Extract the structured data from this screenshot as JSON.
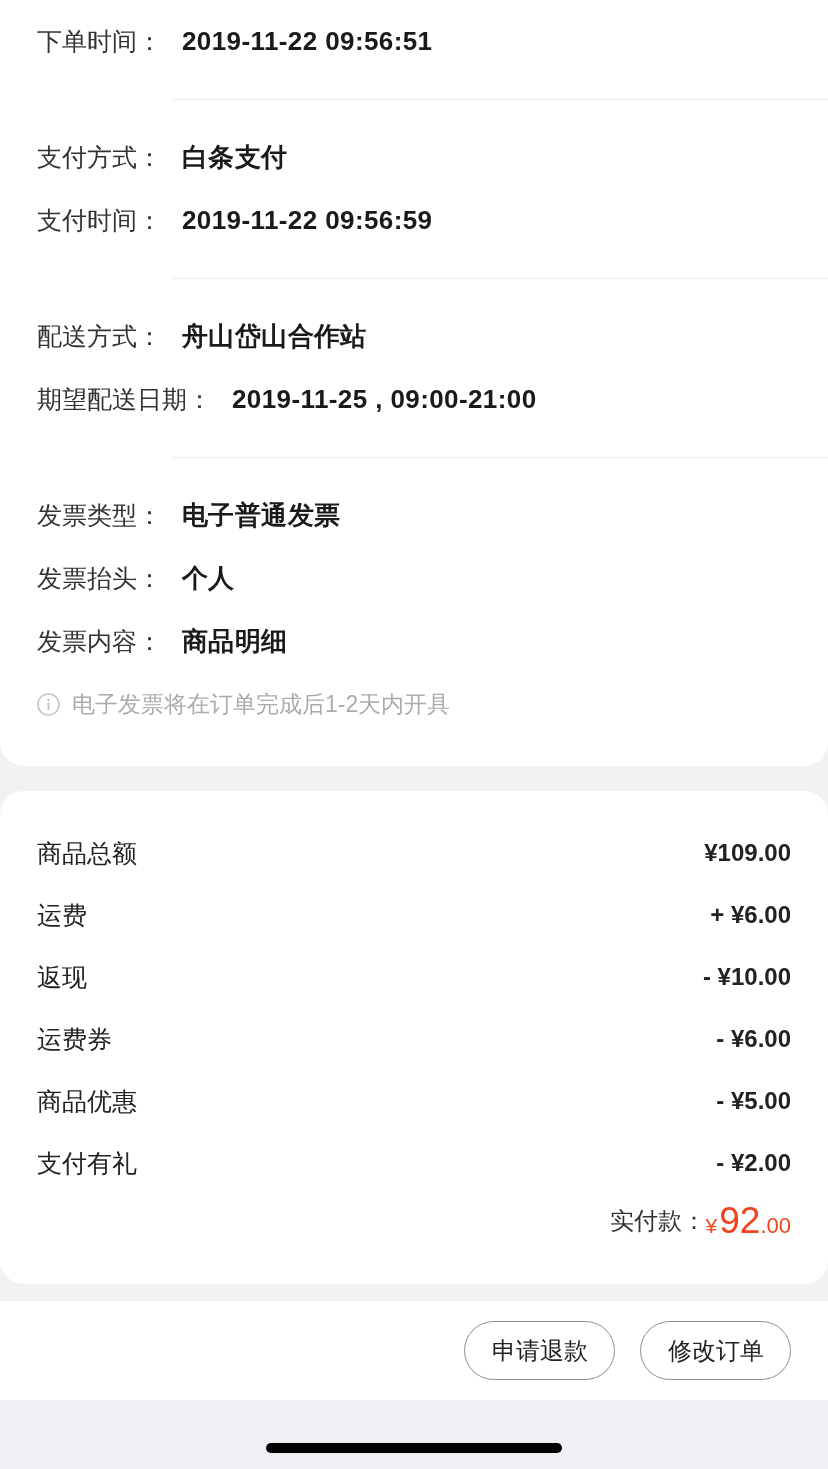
{
  "order_info": {
    "groups": [
      {
        "rows": [
          {
            "label": "下单时间：",
            "value": "2019-11-22 09:56:51"
          }
        ]
      },
      {
        "rows": [
          {
            "label": "支付方式：",
            "value": "白条支付"
          },
          {
            "label": "支付时间：",
            "value": "2019-11-22 09:56:59"
          }
        ]
      },
      {
        "rows": [
          {
            "label": "配送方式：",
            "value": "舟山岱山合作站"
          },
          {
            "label": "期望配送日期：",
            "value": "2019-11-25 , 09:00-21:00"
          }
        ]
      },
      {
        "rows": [
          {
            "label": "发票类型：",
            "value": "电子普通发票"
          },
          {
            "label": "发票抬头：",
            "value": "个人"
          },
          {
            "label": "发票内容：",
            "value": "商品明细"
          }
        ],
        "note": "电子发票将在订单完成后1-2天内开具"
      }
    ]
  },
  "price_summary": {
    "rows": [
      {
        "label": "商品总额",
        "value": "¥109.00"
      },
      {
        "label": "运费",
        "value": "+ ¥6.00"
      },
      {
        "label": "返现",
        "value": "- ¥10.00"
      },
      {
        "label": "运费券",
        "value": "- ¥6.00"
      },
      {
        "label": "商品优惠",
        "value": "- ¥5.00"
      },
      {
        "label": "支付有礼",
        "value": "- ¥2.00"
      }
    ],
    "total": {
      "label": "实付款：",
      "currency": "¥",
      "integer": "92",
      "decimal": ".00"
    }
  },
  "actions": [
    {
      "label": "申请退款"
    },
    {
      "label": "修改订单"
    }
  ]
}
